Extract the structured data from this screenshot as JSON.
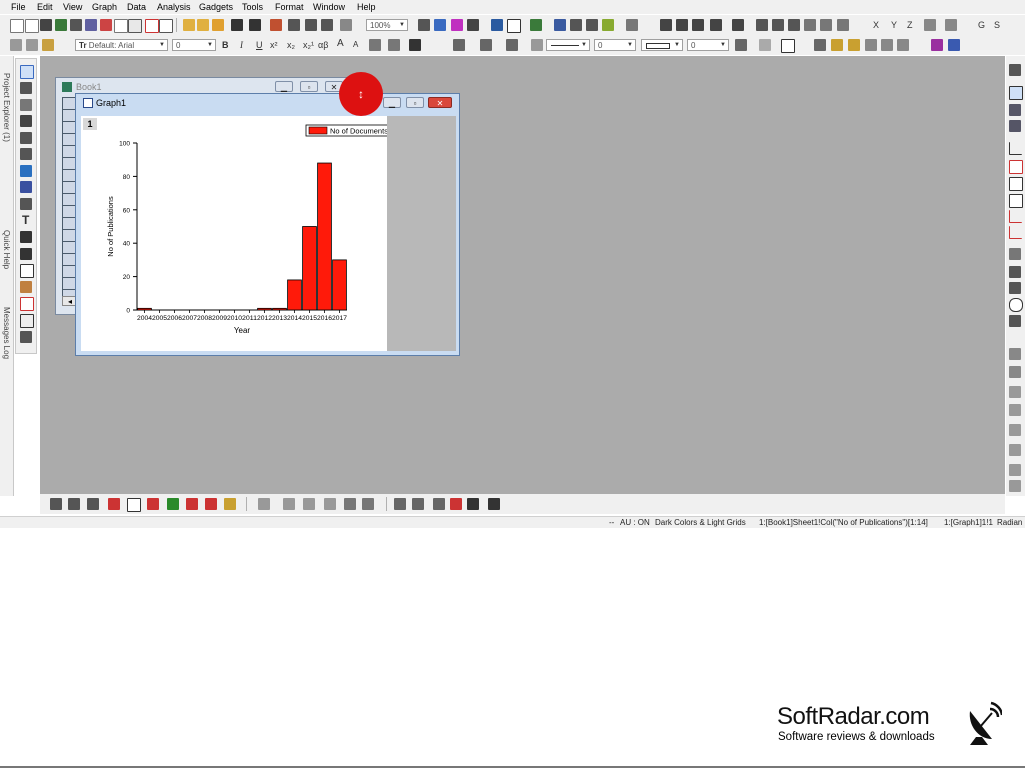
{
  "menu": [
    "File",
    "Edit",
    "View",
    "Graph",
    "Data",
    "Analysis",
    "Gadgets",
    "Tools",
    "Format",
    "Window",
    "Help"
  ],
  "toolbar_top": {
    "zoom_value": "100%",
    "letters": [
      "X",
      "Y",
      "Z",
      "G",
      "S"
    ]
  },
  "toolbar_format": {
    "font_value": "Default: Arial",
    "font_prefix": "Tr",
    "font_size_value": "0",
    "style_buttons": [
      "B",
      "I",
      "U",
      "x²",
      "x₂",
      "x₂¹",
      "αβ",
      "A",
      "A"
    ],
    "line_width_value": "0",
    "border_value": "0"
  },
  "left_tabs": [
    "Project Explorer (1)",
    "Quick Help",
    "Messages Log"
  ],
  "book_window": {
    "title": "Book1",
    "scroll_left": "◂"
  },
  "graph_window": {
    "title": "Graph1",
    "layer_label": "1"
  },
  "chart_data": {
    "type": "bar",
    "categories": [
      "2004",
      "2005",
      "2006",
      "2007",
      "2008",
      "2009",
      "2010",
      "2011",
      "2012",
      "2013",
      "2014",
      "2015",
      "2016",
      "2017"
    ],
    "values": [
      1,
      0,
      0,
      0,
      0,
      0,
      0,
      0,
      1,
      1,
      18,
      50,
      88,
      30
    ],
    "xlabel": "Year",
    "ylabel": "No of Publications",
    "ylim": [
      0,
      100
    ],
    "yticks": [
      0,
      20,
      40,
      60,
      80,
      100
    ],
    "xtick_labels": [
      "2004",
      "2005",
      "2006",
      "2007",
      "2008",
      "2009",
      "2010",
      "2011",
      "2012",
      "2013",
      "2014",
      "2015",
      "2016",
      "2017"
    ],
    "legend": "No of Documents",
    "legend_position": "top-right",
    "bar_color": "#ff1a0a"
  },
  "statusbar": {
    "segments": [
      "--",
      "AU : ON",
      "Dark Colors & Light Grids",
      "1:[Book1]Sheet1!Col(\"No of Publications\")[1:14]",
      "1:[Graph1]1!1",
      "Radian"
    ]
  },
  "brand": {
    "name": "SoftRadar.com",
    "tagline": "Software reviews & downloads"
  },
  "colors": {
    "workspace": "#ababab",
    "title_active": "#c9dcf2",
    "close_button": "#d9473a",
    "cursor_highlight": "#dd1111"
  }
}
